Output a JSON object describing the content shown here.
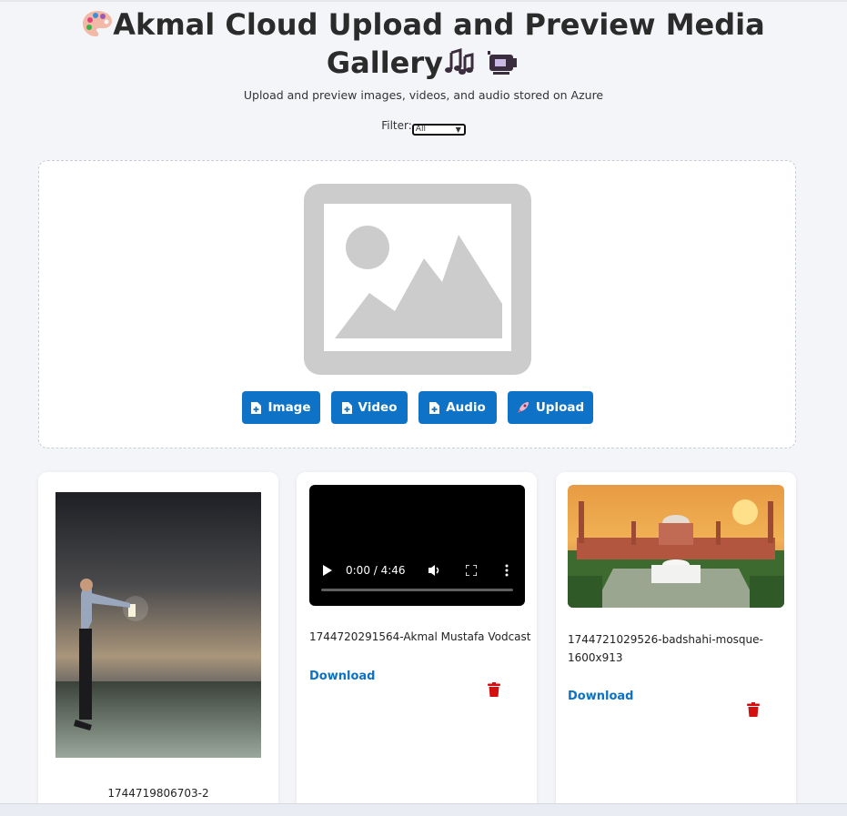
{
  "header": {
    "title_line1": "Akmal Cloud Upload and Preview Media",
    "title_line2": "Gallery",
    "subtitle": "Upload and preview images, videos, and audio stored on Azure"
  },
  "filter": {
    "label": "Filter:",
    "selected": "All"
  },
  "upload": {
    "buttons": {
      "image": "Image",
      "video": "Video",
      "audio": "Audio",
      "upload": "Upload"
    }
  },
  "gallery": {
    "items": [
      {
        "type": "image",
        "filename": "1744719806703-2"
      },
      {
        "type": "video",
        "filename": "1744720291564-Akmal Mustafa Vodcast",
        "time": "0:00 / 4:46",
        "download": "Download"
      },
      {
        "type": "image",
        "filename": "1744721029526-badshahi-mosque-1600x913",
        "download": "Download"
      }
    ]
  },
  "colors": {
    "accent": "#0e73c7",
    "delete": "#d40f0f",
    "background": "#f4f5f9"
  }
}
